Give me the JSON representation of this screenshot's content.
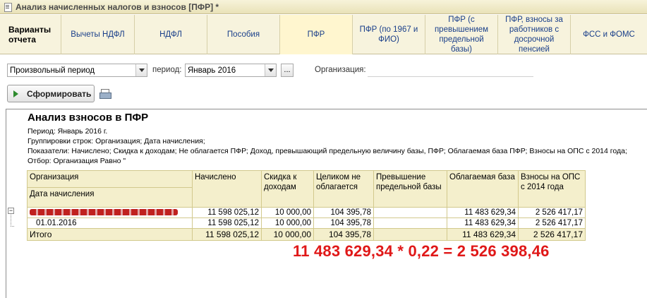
{
  "window": {
    "title": "Анализ начисленных налогов и взносов [ПФР] *"
  },
  "tabs": [
    {
      "label": "Варианты отчета"
    },
    {
      "label": "Вычеты НДФЛ"
    },
    {
      "label": "НДФЛ"
    },
    {
      "label": "Пособия"
    },
    {
      "label": "ПФР"
    },
    {
      "label": "ПФР (по 1967 и ФИО)"
    },
    {
      "label": "ПФР (с превышением предельной базы)"
    },
    {
      "label": "ПФР, взносы за работников с досрочной пенсией"
    },
    {
      "label": "ФСС и ФОМС"
    }
  ],
  "filters": {
    "period_type": "Произвольный период",
    "period_label": "период:",
    "period_value": "Январь 2016",
    "ellipsis": "...",
    "org_label": "Организация:",
    "org_value": ""
  },
  "toolbar": {
    "generate_label": "Сформировать"
  },
  "report": {
    "title": "Анализ взносов в ПФР",
    "period_line": "Период: Январь 2016 г.",
    "grouping_line": "Группировки строк: Организация; Дата начисления;",
    "indicators_line": "Показатели: Начислено; Скидка к доходам; Не облагается ПФР; Доход, превышающий предельную величину базы, ПФР; Облагаемая база ПФР; Взносы на ОПС с 2014 года;",
    "selection_line": "Отбор: Организация Равно \"",
    "table": {
      "headers": {
        "org": "Организация",
        "date": "Дата начисления",
        "accrued": "Начислено",
        "discount": "Скидка к доходам",
        "non_taxable": "Целиком не облагается",
        "excess": "Превышение предельной базы",
        "taxable_base": "Облагаемая база",
        "contributions": "Взносы на ОПС с 2014 года"
      },
      "org_row": {
        "accrued": "11 598 025,12",
        "discount": "10 000,00",
        "non_taxable": "104 395,78",
        "excess": "",
        "taxable_base": "11 483 629,34",
        "contributions": "2 526 417,17"
      },
      "date_row": {
        "date": "01.01.2016",
        "accrued": "11 598 025,12",
        "discount": "10 000,00",
        "non_taxable": "104 395,78",
        "excess": "",
        "taxable_base": "11 483 629,34",
        "contributions": "2 526 417,17"
      },
      "total_row": {
        "label": "Итого",
        "accrued": "11 598 025,12",
        "discount": "10 000,00",
        "non_taxable": "104 395,78",
        "excess": "",
        "taxable_base": "11 483 629,34",
        "contributions": "2 526 417,17"
      }
    }
  },
  "annotation": {
    "formula": "11 483 629,34 * 0,22 = 2 526 398,46"
  },
  "colors": {
    "tab_bar": "#f7f3dd",
    "table_header": "#f4efcc",
    "annotation": "#e01818",
    "tab_text": "#1a3f8a"
  }
}
